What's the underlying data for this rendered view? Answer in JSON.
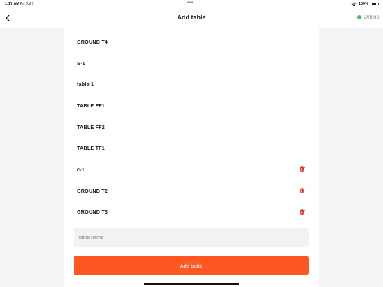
{
  "status_bar": {
    "time": "1:17 AM",
    "date": "Fri Jul 7",
    "dots": "•••",
    "battery_percent": "100%"
  },
  "nav": {
    "title": "Add table",
    "status_label": "Online",
    "status_color": "#34c759"
  },
  "tables": [
    {
      "name": "GROUND T4",
      "deletable": false
    },
    {
      "name": "S-1",
      "deletable": false
    },
    {
      "name": "table 1",
      "deletable": false
    },
    {
      "name": "TABLE FF1",
      "deletable": false
    },
    {
      "name": "TABLE FF2",
      "deletable": false
    },
    {
      "name": "TABLE TF1",
      "deletable": false
    },
    {
      "name": "c-1",
      "deletable": true
    },
    {
      "name": "GROUND T2",
      "deletable": true
    },
    {
      "name": "GROUND T3",
      "deletable": true
    }
  ],
  "form": {
    "input_value": "",
    "input_placeholder": "Table name",
    "submit_label": "Add table"
  },
  "colors": {
    "accent": "#ff5722",
    "delete": "#e53935"
  },
  "icons": {
    "back": "chevron-left-icon",
    "delete": "trash-icon",
    "wifi": "wifi-icon",
    "battery": "battery-icon"
  }
}
